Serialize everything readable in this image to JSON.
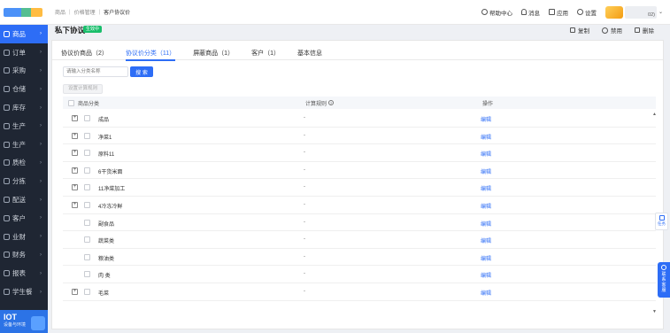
{
  "sidebar": {
    "items": [
      {
        "label": "商品",
        "active": true
      },
      {
        "label": "订单"
      },
      {
        "label": "采购"
      },
      {
        "label": "仓储"
      },
      {
        "label": "库存"
      },
      {
        "label": "生产"
      },
      {
        "label": "生产"
      },
      {
        "label": "质检"
      },
      {
        "label": "分拣"
      },
      {
        "label": "配送"
      },
      {
        "label": "客户"
      },
      {
        "label": "业财"
      },
      {
        "label": "财务"
      },
      {
        "label": "报表"
      },
      {
        "label": "学生餐"
      }
    ],
    "iot_title": "IOT",
    "iot_subtitle": "设备与环境"
  },
  "header": {
    "breadcrumbs": [
      "商品",
      "价格管理",
      "客户协议价"
    ],
    "help": "帮助中心",
    "messages": "消息",
    "apps": "应用",
    "settings": "设置",
    "user_suffix": "02)"
  },
  "page": {
    "title": "私下协议",
    "status": "生效中",
    "actions": {
      "copy": "复制",
      "disable": "禁用",
      "delete": "删除"
    }
  },
  "tabs": [
    {
      "label": "协议价商品（2）"
    },
    {
      "label": "协议价分类（11）",
      "active": true
    },
    {
      "label": "屏蔽商品（1）"
    },
    {
      "label": "客户（1）"
    },
    {
      "label": "基本信息"
    }
  ],
  "search": {
    "placeholder": "请输入分类名称",
    "button": "搜 索"
  },
  "set_rule_button": "设置计算规则",
  "table": {
    "headers": {
      "category": "商品分类",
      "rule": "计算规则",
      "ops": "操作"
    },
    "rows": [
      {
        "name": "成品",
        "rule": "-",
        "op": "编辑",
        "expandable": true
      },
      {
        "name": "净菜1",
        "rule": "-",
        "op": "编辑",
        "expandable": true
      },
      {
        "name": "原料11",
        "rule": "-",
        "op": "编辑",
        "expandable": true
      },
      {
        "name": "6干货米面",
        "rule": "-",
        "op": "编辑",
        "expandable": true
      },
      {
        "name": "11净菜加工",
        "rule": "-",
        "op": "编辑",
        "expandable": true
      },
      {
        "name": "4冷冻冷鲜",
        "rule": "-",
        "op": "编辑",
        "expandable": true
      },
      {
        "name": "副食品",
        "rule": "-",
        "op": "编辑",
        "expandable": false
      },
      {
        "name": "蔬菜类",
        "rule": "-",
        "op": "编辑",
        "expandable": false
      },
      {
        "name": "粮油类",
        "rule": "-",
        "op": "编辑",
        "expandable": false
      },
      {
        "name": "肉 类",
        "rule": "-",
        "op": "编辑",
        "expandable": false
      },
      {
        "name": "毛菜",
        "rule": "-",
        "op": "编辑",
        "expandable": true
      }
    ]
  },
  "floating": {
    "task": "任务",
    "service": [
      "联",
      "系",
      "客",
      "服"
    ]
  }
}
